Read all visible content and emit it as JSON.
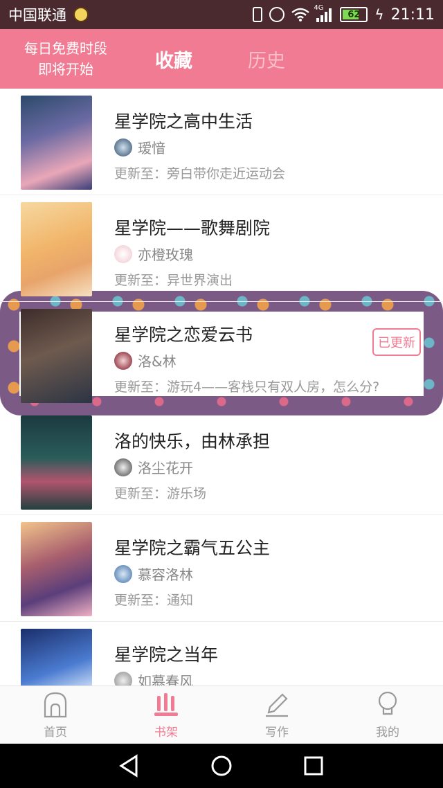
{
  "status_bar": {
    "carrier": "中国联通",
    "network": "4G",
    "battery": "62",
    "time": "21:11"
  },
  "header": {
    "promo_line1": "每日免费时段",
    "promo_line2": "即将开始",
    "tab_favorites": "收藏",
    "tab_history": "历史"
  },
  "items": [
    {
      "title": "星学院之高中生活",
      "author": "瑷愔",
      "update": "更新至：旁白带你走近运动会",
      "badge": ""
    },
    {
      "title": "星学院——歌舞剧院",
      "author": "亦橙玫瑰",
      "update": "更新至：异世界演出",
      "badge": ""
    },
    {
      "title": "星学院之恋爱云书",
      "author": "洛&林",
      "update": "更新至：游玩4——客栈只有双人房，怎么分?",
      "badge": "已更新"
    },
    {
      "title": "洛的快乐，由林承担",
      "author": "洛尘花开",
      "update": "更新至：游乐场",
      "badge": ""
    },
    {
      "title": "星学院之霸气五公主",
      "author": "慕容洛林",
      "update": "更新至：通知",
      "badge": ""
    },
    {
      "title": "星学院之当年",
      "author": "如慕春风",
      "update": "",
      "badge": ""
    }
  ],
  "bottom_nav": {
    "home": "首页",
    "shelf": "书架",
    "write": "写作",
    "mine": "我的"
  },
  "colors": {
    "accent": "#f07b92",
    "status_bar": "#4a2a2f"
  }
}
